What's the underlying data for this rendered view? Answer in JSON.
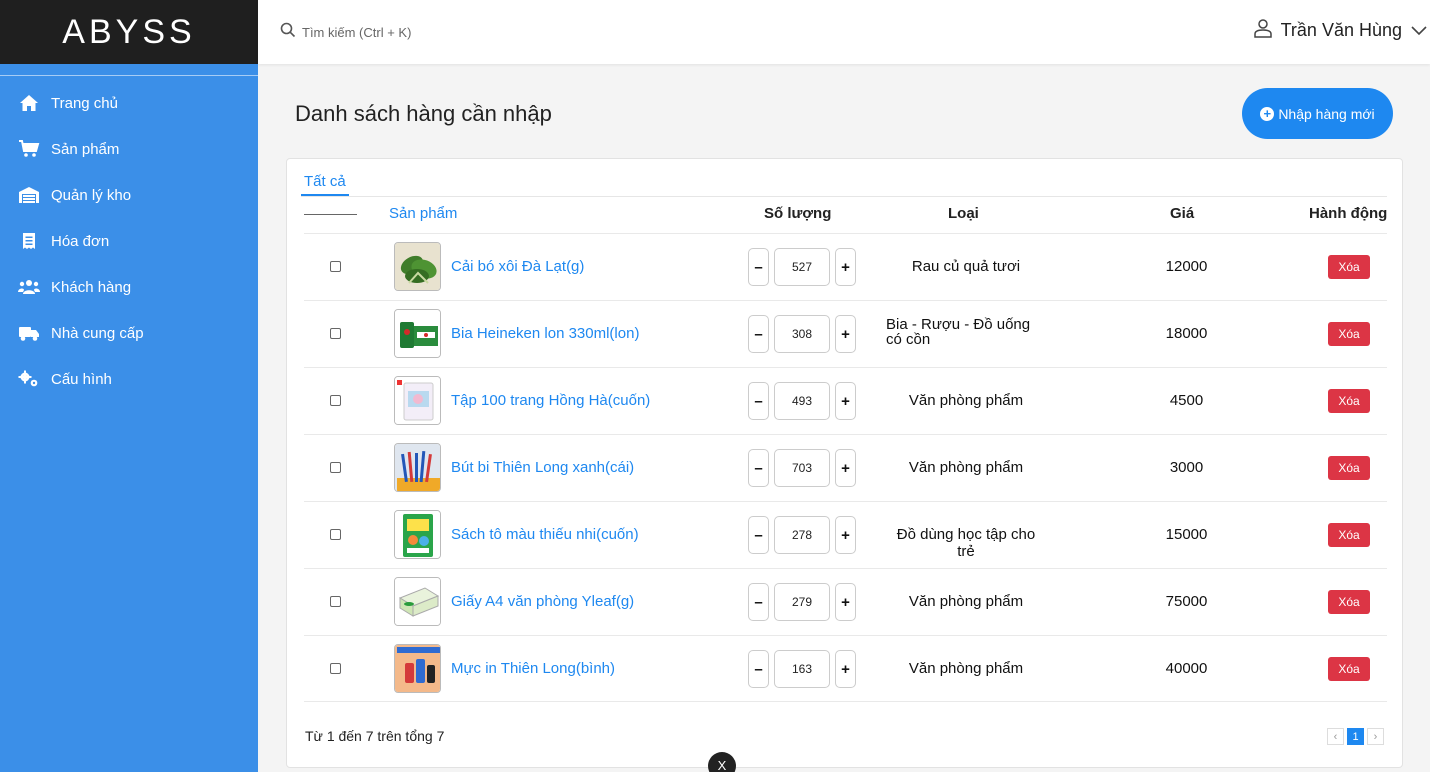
{
  "app": {
    "logo": "ABYSS"
  },
  "sidebar": {
    "items": [
      {
        "label": "Trang chủ",
        "icon": "home-icon"
      },
      {
        "label": "Sản phẩm",
        "icon": "cart-icon"
      },
      {
        "label": "Quản lý kho",
        "icon": "warehouse-icon"
      },
      {
        "label": "Hóa đơn",
        "icon": "invoice-icon"
      },
      {
        "label": "Khách hàng",
        "icon": "users-icon"
      },
      {
        "label": "Nhà cung cấp",
        "icon": "truck-icon"
      },
      {
        "label": "Cấu hình",
        "icon": "gears-icon"
      }
    ]
  },
  "header": {
    "search_placeholder": "Tìm kiếm (Ctrl + K)",
    "user_name": "Trần Văn Hùng"
  },
  "main": {
    "title": "Danh sách hàng cần nhập",
    "new_button": "Nhập hàng mới",
    "tab_all": "Tất cả",
    "columns": {
      "product": "Sản phẩm",
      "quantity": "Số lượng",
      "category": "Loại",
      "price": "Giá",
      "action": "Hành động"
    },
    "delete_label": "Xóa",
    "rows": [
      {
        "name": "Cải bó xôi Đà Lạt(g)",
        "qty": "527",
        "category": "Rau củ quả tươi",
        "price": "12000",
        "thumb": "spinach"
      },
      {
        "name": "Bia Heineken lon 330ml(lon)",
        "qty": "308",
        "category": "Bia - Rượu - Đồ uống có cồn",
        "price": "18000",
        "thumb": "beer"
      },
      {
        "name": "Tập 100 trang Hồng Hà(cuốn)",
        "qty": "493",
        "category": "Văn phòng phẩm",
        "price": "4500",
        "thumb": "notebook"
      },
      {
        "name": "Bút bi Thiên Long xanh(cái)",
        "qty": "703",
        "category": "Văn phòng phẩm",
        "price": "3000",
        "thumb": "pens"
      },
      {
        "name": "Sách tô màu thiếu nhi(cuốn)",
        "qty": "278",
        "category": "Đồ dùng học tập cho trẻ",
        "price": "15000",
        "thumb": "coloring-book"
      },
      {
        "name": "Giấy A4 văn phòng Yleaf(g)",
        "qty": "279",
        "category": "Văn phòng phẩm",
        "price": "75000",
        "thumb": "paper"
      },
      {
        "name": "Mực in Thiên Long(bình)",
        "qty": "163",
        "category": "Văn phòng phẩm",
        "price": "40000",
        "thumb": "ink"
      }
    ],
    "footer_info": "Từ 1 đến 7 trên tổng 7",
    "pagination": {
      "prev": "‹",
      "current": "1",
      "next": "›"
    }
  },
  "floating": {
    "label": "X"
  },
  "colors": {
    "sidebar": "#3b8fe8",
    "logo_bar": "#1f1f1f",
    "accent": "#1e88f0",
    "danger": "#dc3545"
  }
}
